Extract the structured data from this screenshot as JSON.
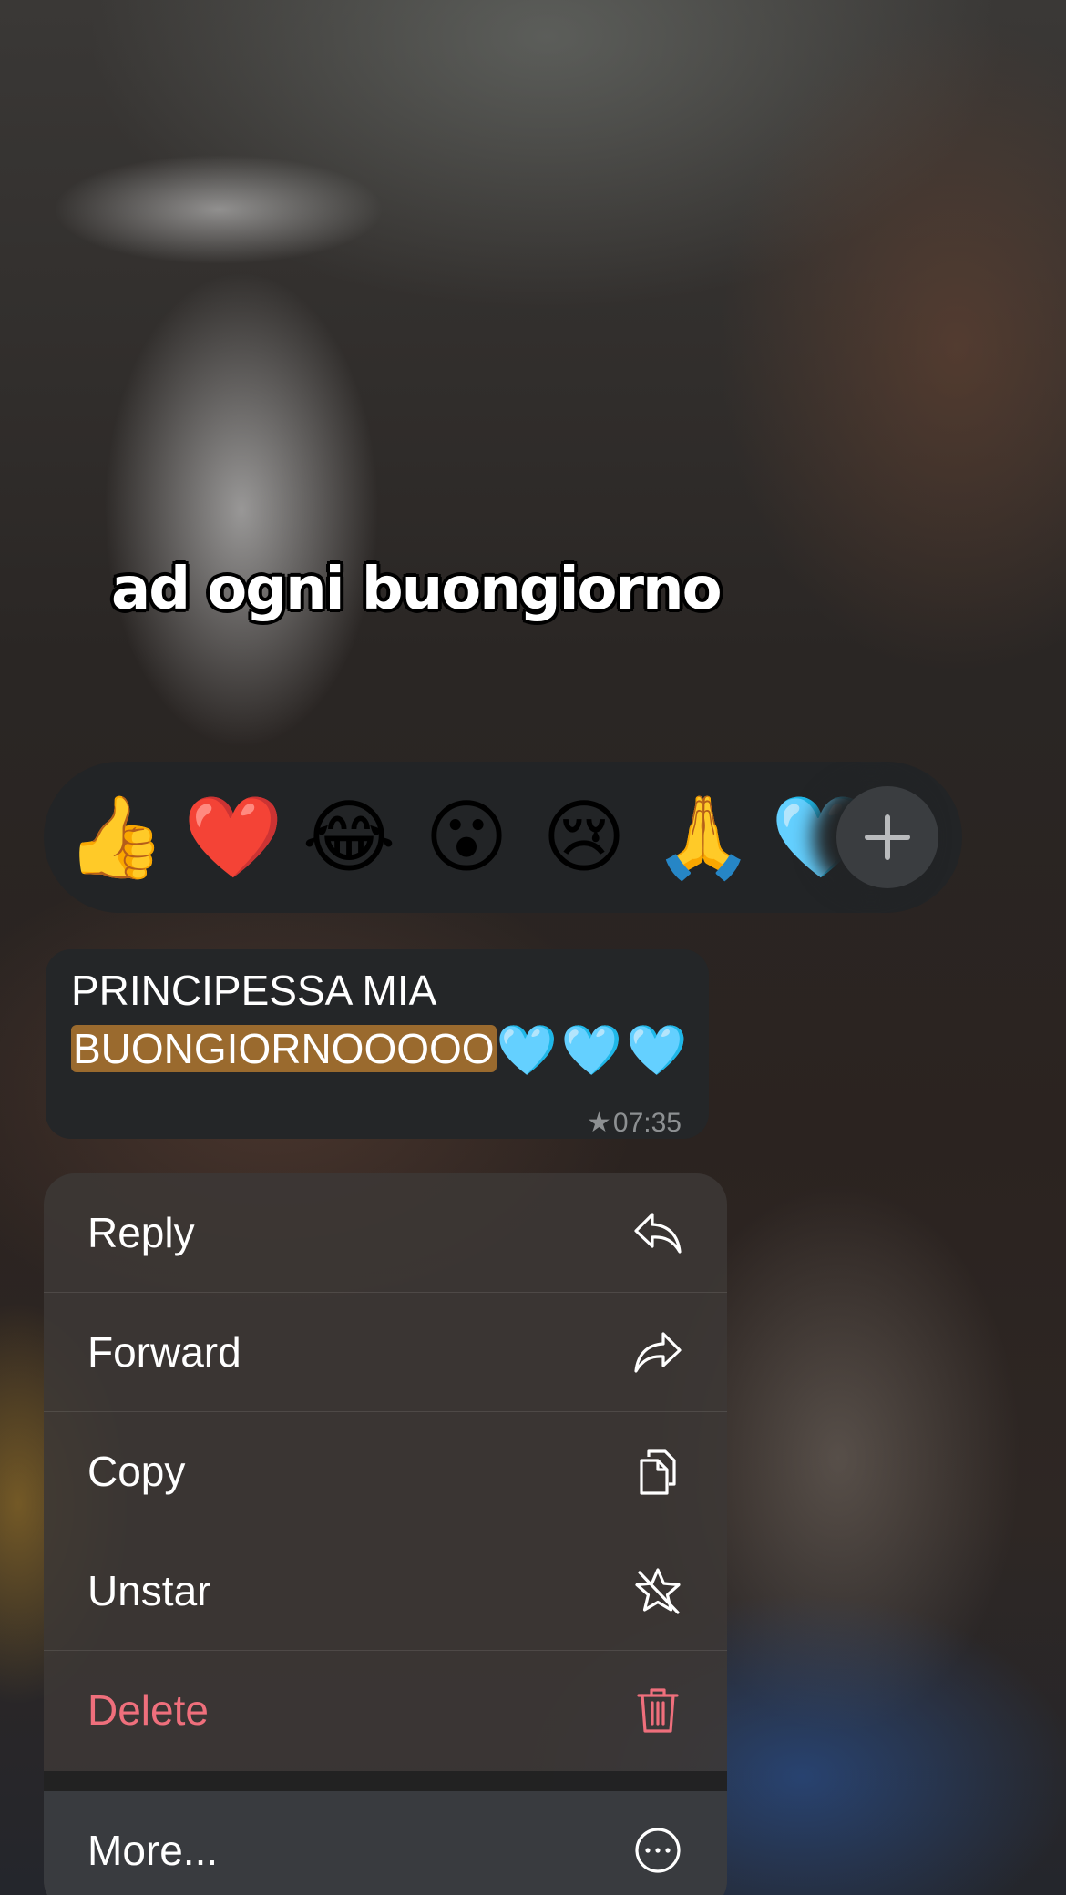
{
  "overlay": {
    "caption": "ad ogni buongiorno"
  },
  "reactions": {
    "items": [
      {
        "emoji": "👍",
        "name": "thumbs-up"
      },
      {
        "emoji": "❤️",
        "name": "red-heart"
      },
      {
        "emoji": "😂",
        "name": "tears-of-joy"
      },
      {
        "emoji": "😮",
        "name": "surprised"
      },
      {
        "emoji": "😢",
        "name": "crying"
      },
      {
        "emoji": "🙏",
        "name": "folded-hands"
      },
      {
        "emoji": "🩵",
        "name": "light-blue-heart"
      }
    ],
    "more_icon": "plus-icon"
  },
  "message": {
    "line1": "PRINCIPESSA MIA",
    "highlighted_text": "BUONGIORNOOOOO",
    "trailing_emoji": "🩵🩵🩵",
    "starred": true,
    "star_glyph": "★",
    "time": "07:35",
    "highlight_color": "#9a6a2e"
  },
  "menu": {
    "reply": {
      "label": "Reply",
      "icon": "reply-icon"
    },
    "forward": {
      "label": "Forward",
      "icon": "forward-icon"
    },
    "copy": {
      "label": "Copy",
      "icon": "copy-icon"
    },
    "unstar": {
      "label": "Unstar",
      "icon": "unstar-icon"
    },
    "delete": {
      "label": "Delete",
      "icon": "trash-icon",
      "color": "#ef6f7c"
    },
    "more": {
      "label": "More...",
      "icon": "more-icon"
    }
  }
}
